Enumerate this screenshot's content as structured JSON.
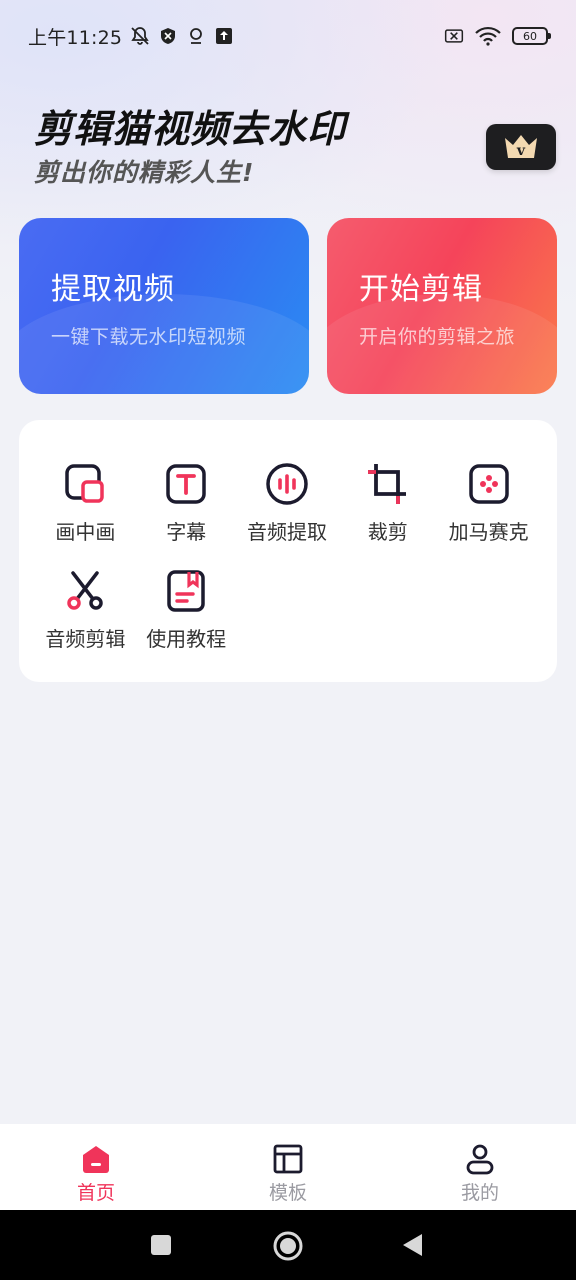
{
  "status_bar": {
    "time": "上午11:25",
    "battery": "60",
    "icons": [
      "bell-off-icon",
      "shield-icon",
      "location-pin-icon",
      "upload-icon",
      "sim-off-icon",
      "wifi-icon",
      "battery-icon"
    ]
  },
  "header": {
    "title": "剪辑猫视频去水印",
    "subtitle": "剪出你的精彩人生!",
    "vip_badge_icon": "vip-crown-icon",
    "vip_badge_letter": "v"
  },
  "cards": {
    "extract": {
      "title": "提取视频",
      "subtitle": "一键下载无水印短视频"
    },
    "edit": {
      "title": "开始剪辑",
      "subtitle": "开启你的剪辑之旅"
    }
  },
  "tools": [
    {
      "label": "画中画",
      "icon": "picture-in-picture-icon"
    },
    {
      "label": "字幕",
      "icon": "subtitle-icon"
    },
    {
      "label": "音频提取",
      "icon": "audio-extract-icon"
    },
    {
      "label": "裁剪",
      "icon": "crop-icon"
    },
    {
      "label": "加马赛克",
      "icon": "mosaic-icon"
    },
    {
      "label": "音频剪辑",
      "icon": "scissors-icon"
    },
    {
      "label": "使用教程",
      "icon": "tutorial-book-icon"
    }
  ],
  "bottom_nav": [
    {
      "label": "首页",
      "icon": "home-icon",
      "active": true
    },
    {
      "label": "模板",
      "icon": "template-icon",
      "active": false
    },
    {
      "label": "我的",
      "icon": "profile-icon",
      "active": false
    }
  ],
  "colors": {
    "accent": "#f0345a",
    "extract_card": "#3a63f0",
    "edit_card": "#f5445a",
    "icon_dark": "#1c1b2e"
  },
  "system_nav": [
    "recent-apps-icon",
    "home-circle-icon",
    "back-icon"
  ]
}
